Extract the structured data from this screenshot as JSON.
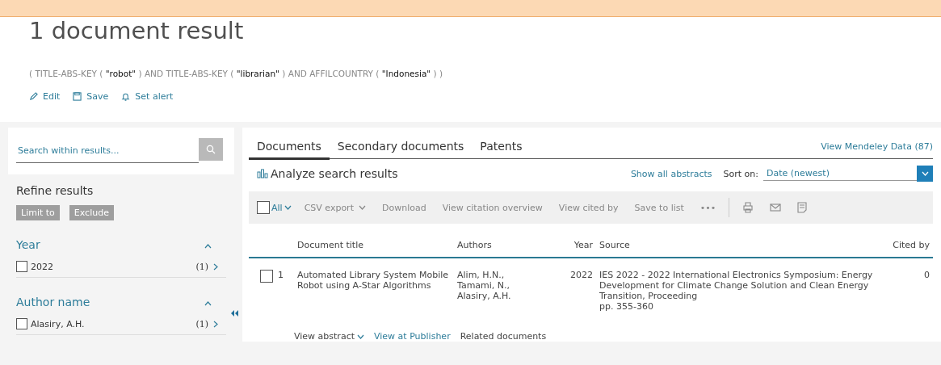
{
  "title": "1 document result",
  "query": "( TITLE-ABS-KEY ( **\"robot\"** )  AND  TITLE-ABS-KEY ( **\"librarian\"** )  AND  AFFILCOUNTRY ( **\"Indonesia\"** ) )",
  "query_actions": [
    {
      "kind": "edit",
      "label": "Edit"
    },
    {
      "kind": "save",
      "label": "Save"
    },
    {
      "kind": "alert",
      "label": "Set alert"
    }
  ],
  "sidebar": {
    "search": {
      "placeholder": "Search within results..."
    },
    "refine_title": "Refine results",
    "refine_buttons": [
      "Limit to",
      "Exclude"
    ],
    "facets": [
      {
        "title": "Year",
        "expanded": true,
        "items": [
          {
            "label": "2022",
            "count": "(1)",
            "checked": false
          }
        ]
      },
      {
        "title": "Author name",
        "expanded": true,
        "items": [
          {
            "label": "Alasiry, A.H.",
            "count": "(1)",
            "checked": false
          }
        ]
      }
    ]
  },
  "tabs": [
    {
      "label": "Documents",
      "selected": true
    },
    {
      "label": "Secondary documents",
      "selected": false
    },
    {
      "label": "Patents",
      "selected": false
    }
  ],
  "mendeley_link": "View Mendeley Data (87)",
  "analyze_label": "Analyze search results",
  "show_all_abstracts": "Show all abstracts",
  "sort": {
    "label": "Sort on:",
    "value": "Date (newest)"
  },
  "toolbar": {
    "select_all": {
      "label": "All",
      "checked": false
    },
    "actions": [
      "CSV export",
      "Download",
      "View citation overview",
      "View cited by",
      "Save to list"
    ],
    "more": "•••",
    "icons": [
      {
        "kind": "print"
      },
      {
        "kind": "email"
      },
      {
        "kind": "export"
      }
    ]
  },
  "table": {
    "columns": [
      "Document title",
      "Authors",
      "Year",
      "Source",
      "Cited by"
    ],
    "rows": [
      {
        "number": "1",
        "checked": false,
        "title": "Automated Library System Mobile Robot using A-Star Algorithms",
        "authors": [
          "Alim, H.N.,",
          "Tamami, N.,",
          "Alasiry, A.H."
        ],
        "year": "2022",
        "source": "IES 2022 - 2022 International Electronics Symposium: Energy Development for Climate Change Solution and Clean Energy Transition, Proceeding",
        "pages": "pp. 355-360",
        "cited_by": "0",
        "links": [
          {
            "kind": "dropdown",
            "label": "View abstract"
          },
          {
            "kind": "link",
            "label": "View at Publisher"
          },
          {
            "kind": "plain",
            "label": "Related documents"
          }
        ]
      }
    ]
  }
}
